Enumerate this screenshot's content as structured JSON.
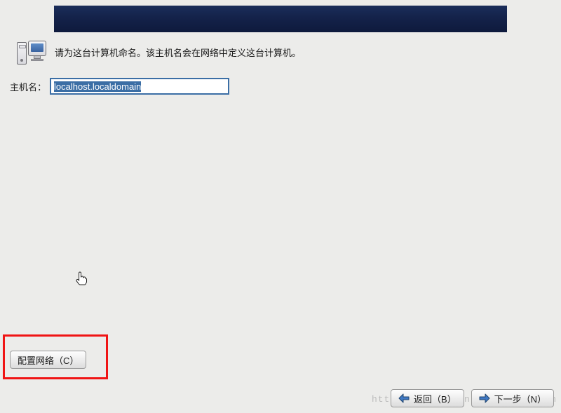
{
  "info_text": "请为这台计算机命名。该主机名会在网络中定义这台计算机。",
  "hostname": {
    "label": "主机名：",
    "value": "localhost.localdomain"
  },
  "buttons": {
    "configure_network": "配置网络（C）",
    "back": "返回（B）",
    "next": "下一步（N）"
  },
  "watermark": "http://blog.csdn.net/testcs_dn"
}
